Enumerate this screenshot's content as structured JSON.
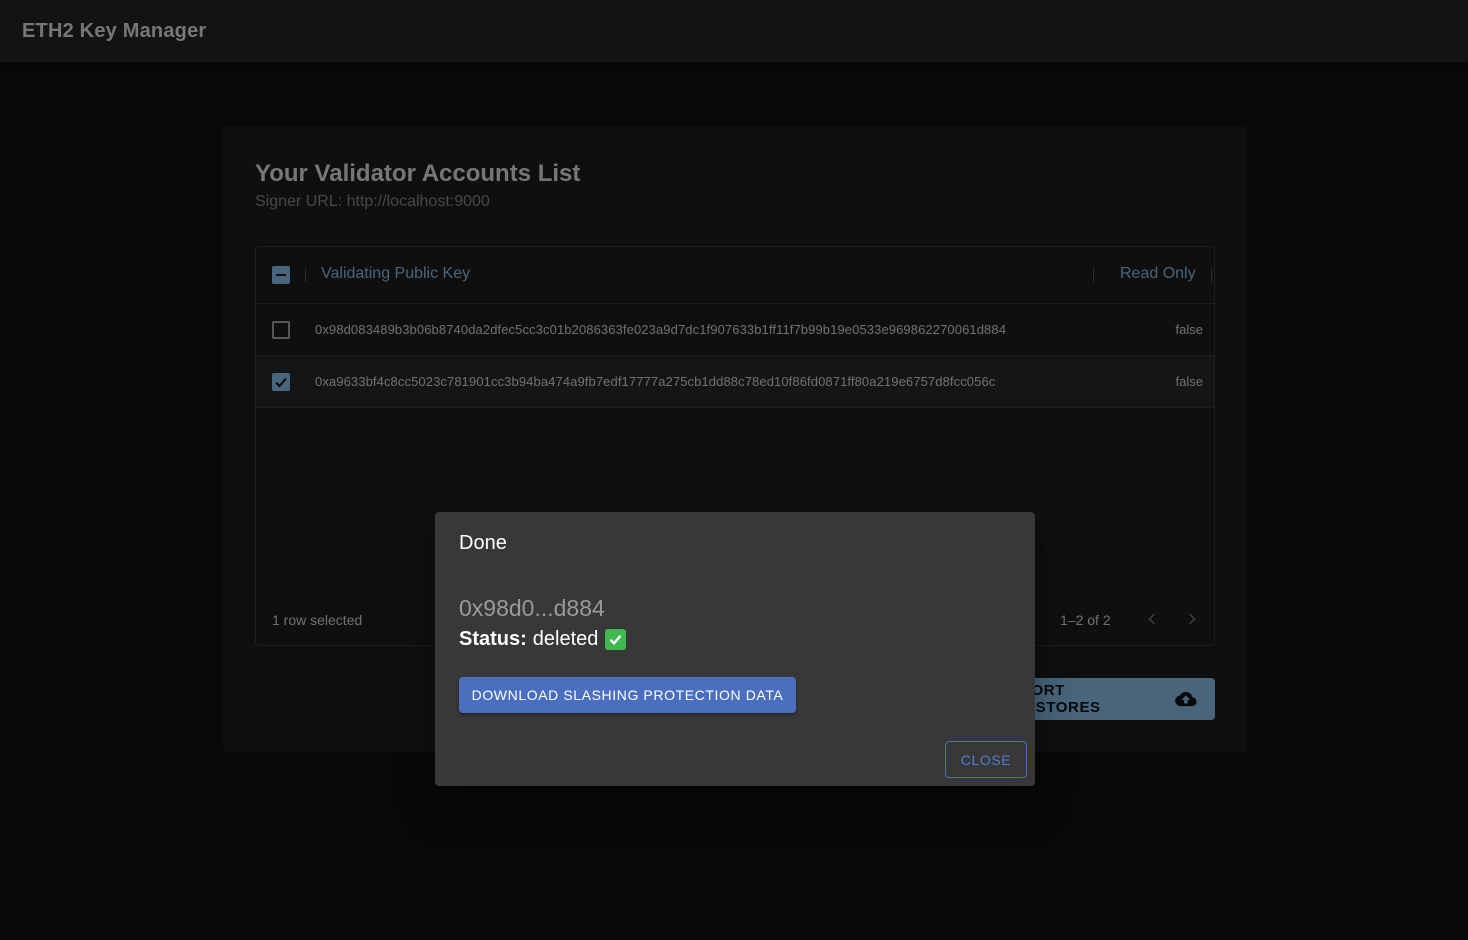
{
  "app": {
    "title": "ETH2 Key Manager"
  },
  "card": {
    "title": "Your Validator Accounts List",
    "subtitle": "Signer URL: http://localhost:9000"
  },
  "grid": {
    "columns": [
      "Validating Public Key",
      "Read Only"
    ],
    "rows": [
      {
        "key": "0x98d083489b3b06b8740da2dfec5cc3c01b2086363fe023a9d7dc1f907633b1ff11f7b99b19e0533e969862270061d884",
        "read_only": "false",
        "selected": false
      },
      {
        "key": "0xa9633bf4c8cc5023c781901cc3b94ba474a9fb7edf17777a275cb1dd88c78ed10f86fd0871ff80a219e6757d8fcc056c",
        "read_only": "false",
        "selected": true
      }
    ],
    "footer": {
      "selected_text": "1 row selected",
      "range_text": "1–2 of 2"
    }
  },
  "import_button": {
    "label": "IMPORT KEYSTORES",
    "icon": "cloud-upload-icon"
  },
  "dialog": {
    "title": "Done",
    "key_short": "0x98d0...d884",
    "status_label": "Status:",
    "status_value": "deleted",
    "status_icon": "check-mark-emoji",
    "download_label": "DOWNLOAD SLASHING PROTECTION DATA",
    "close_label": "CLOSE"
  },
  "colors": {
    "accent": "#90caf9",
    "button_primary": "#4a6fbf",
    "surface": "#1e1e1e",
    "dialog": "#383838",
    "success": "#3fb950"
  }
}
